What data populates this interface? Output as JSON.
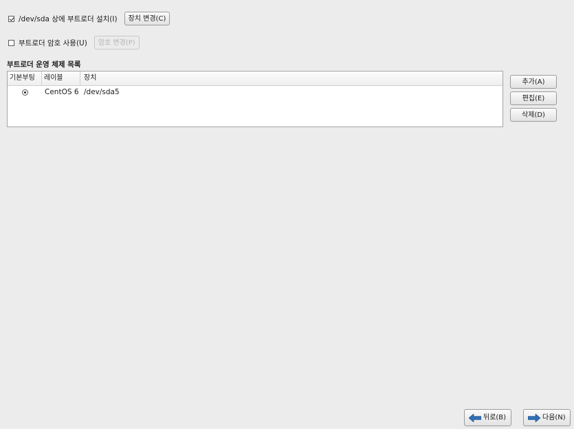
{
  "bootloader": {
    "install_label": "/dev/sda 상에 부트로더 설치(I)",
    "install_checked": true,
    "change_device_label": "장치 변경(C)",
    "password_label": "부트로더 암호 사용(U)",
    "password_checked": false,
    "change_password_label": "암호 변경(P)"
  },
  "os_list": {
    "title": "부트로더 운영 체제 목록",
    "columns": [
      "기본부팅",
      "레이블",
      "장치"
    ],
    "rows": [
      {
        "default": true,
        "label": "CentOS 6",
        "device": "/dev/sda5"
      }
    ],
    "buttons": {
      "add": "추가(A)",
      "edit": "편집(E)",
      "delete": "삭제(D)"
    }
  },
  "nav": {
    "back_label": "뒤로(B)",
    "next_label": "다음(N)",
    "back_icon": "arrow-left-icon",
    "next_icon": "arrow-right-icon",
    "arrow_color": "#2f6fb5"
  }
}
